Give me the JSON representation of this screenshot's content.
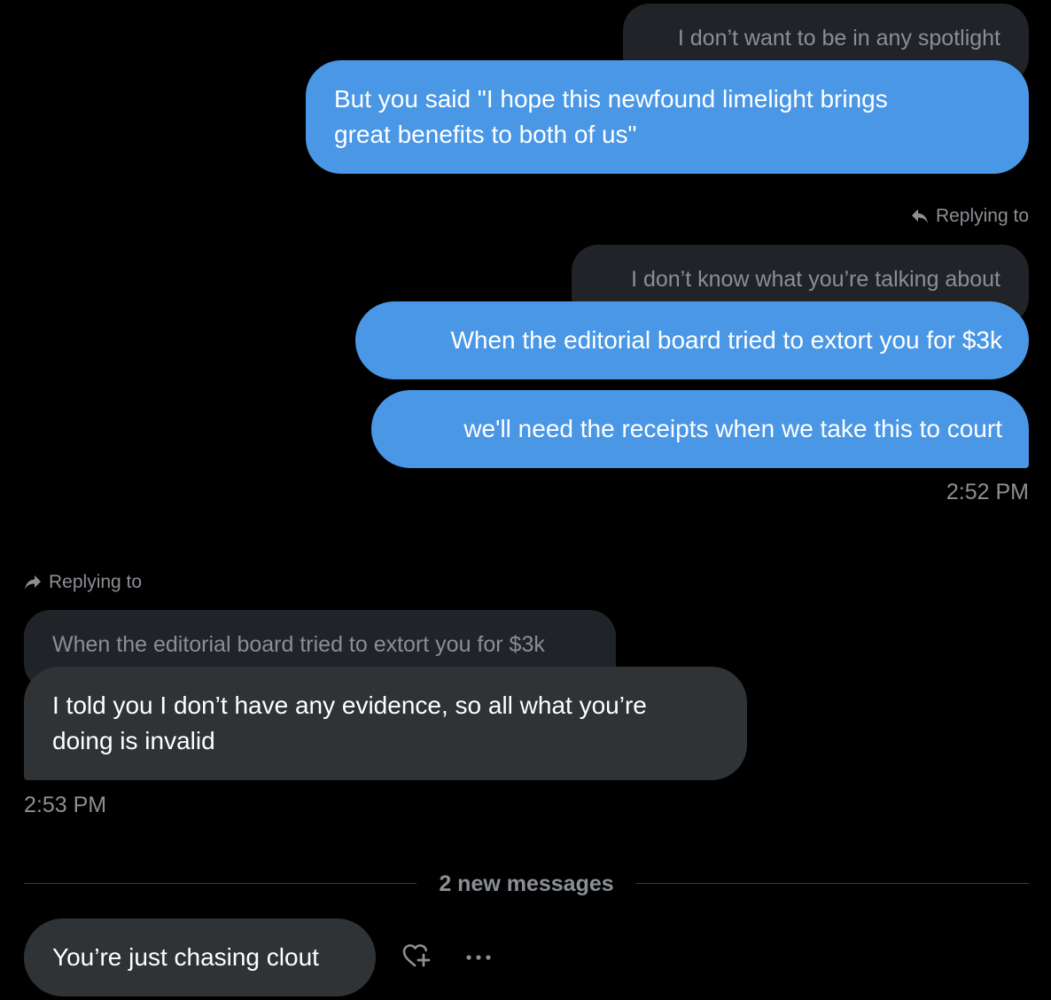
{
  "messages": {
    "m1": {
      "quote": "I don’t want to be in any spotlight",
      "text_line1": "But you said \"I hope this newfound limelight brings",
      "text_line2": "great benefits to both of us\""
    },
    "m2": {
      "reply_label": "Replying to",
      "quote": "I don’t know what you’re talking about",
      "text": "When the editorial board tried to extort you for $3k"
    },
    "m3": {
      "text": "we'll need the receipts when we take this to court",
      "time": "2:52 PM"
    },
    "m4": {
      "reply_label": "Replying to",
      "quote": "When the editorial board tried to extort you for $3k",
      "text_line1": "I told you I don’t have any evidence, so all what you’re",
      "text_line2": "doing is invalid",
      "time": "2:53 PM"
    },
    "divider": {
      "label": "2 new messages"
    },
    "m5": {
      "text": "You’re just chasing clout"
    }
  },
  "icons": {
    "reply_outgoing": "reply-arrow-icon",
    "reply_incoming": "forward-arrow-icon",
    "react": "heart-plus-icon",
    "more": "more-dots-icon"
  },
  "colors": {
    "background": "#000000",
    "outgoing_bubble": "#4a97e6",
    "incoming_bubble": "#2f3336",
    "quote_bubble": "#202327",
    "muted_text": "#8b8f94"
  }
}
